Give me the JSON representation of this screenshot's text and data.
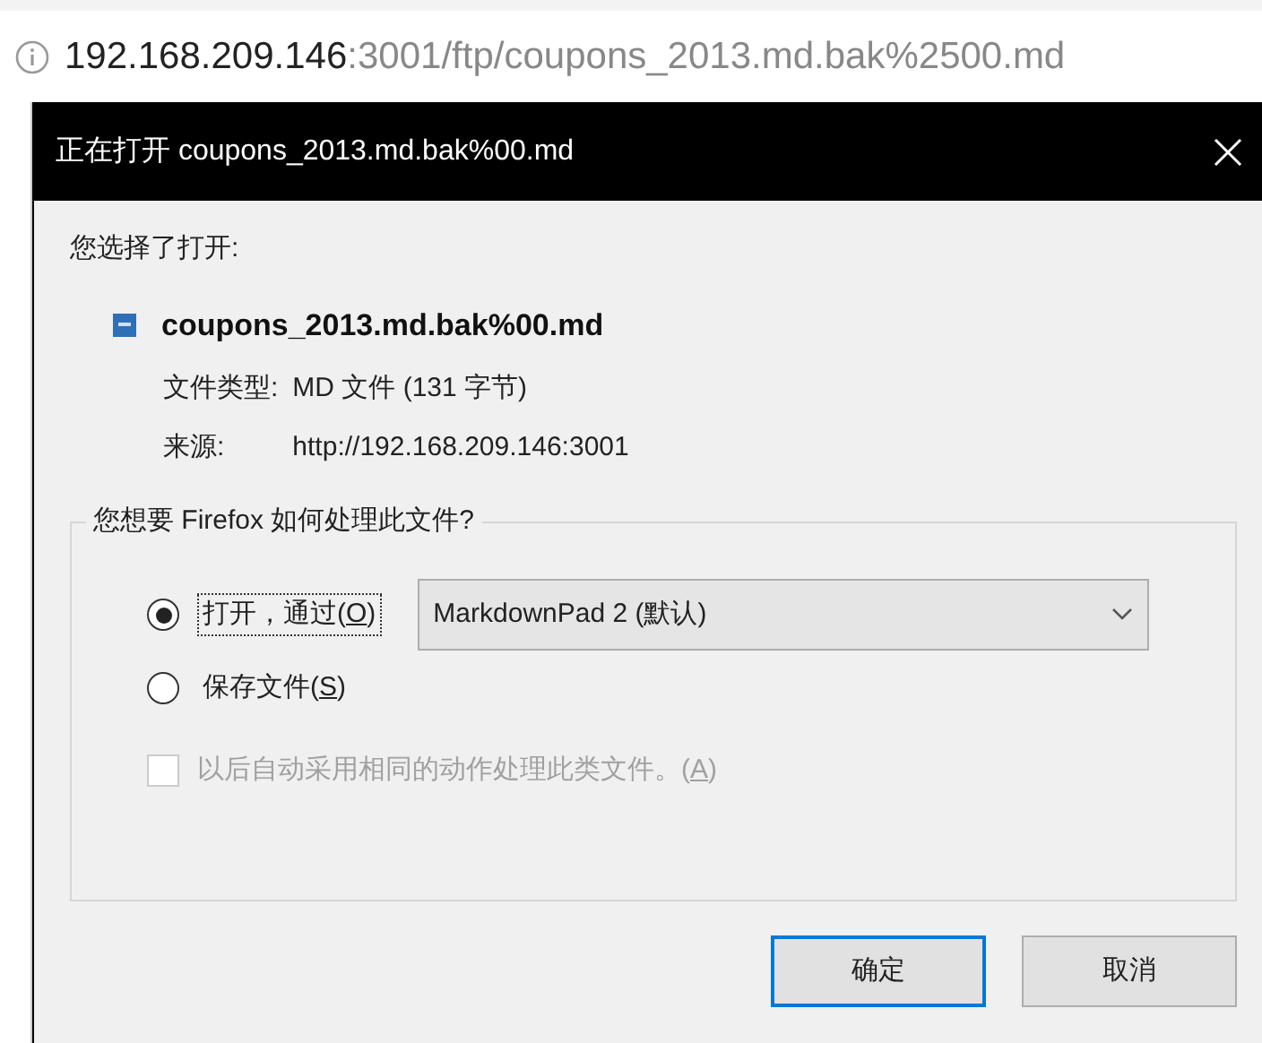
{
  "address_bar": {
    "host": "192.168.209.146",
    "path": ":3001/ftp/coupons_2013.md.bak%2500.md"
  },
  "dialog": {
    "title": "正在打开 coupons_2013.md.bak%00.md",
    "intro": "您选择了打开:",
    "file_name": "coupons_2013.md.bak%00.md",
    "details": [
      {
        "label": "文件类型:",
        "value": "MD 文件 (131 字节)"
      },
      {
        "label": "来源:",
        "value": "http://192.168.209.146:3001"
      }
    ],
    "group_title": "您想要 Firefox 如何处理此文件?",
    "options": [
      {
        "label": "打开，通过(",
        "access_key": "O",
        "label_end": ")",
        "selected": true,
        "focused": true
      },
      {
        "label": "保存文件(",
        "access_key": "S",
        "label_end": ")",
        "selected": false,
        "focused": false
      }
    ],
    "app_select": {
      "value": "MarkdownPad 2 (默认)"
    },
    "remember": {
      "label": "以后自动采用相同的动作处理此类文件。(",
      "access_key": "A",
      "label_end": ")",
      "checked": false,
      "disabled": true
    },
    "buttons": [
      {
        "label": "确定",
        "default": true
      },
      {
        "label": "取消",
        "default": false
      }
    ]
  }
}
